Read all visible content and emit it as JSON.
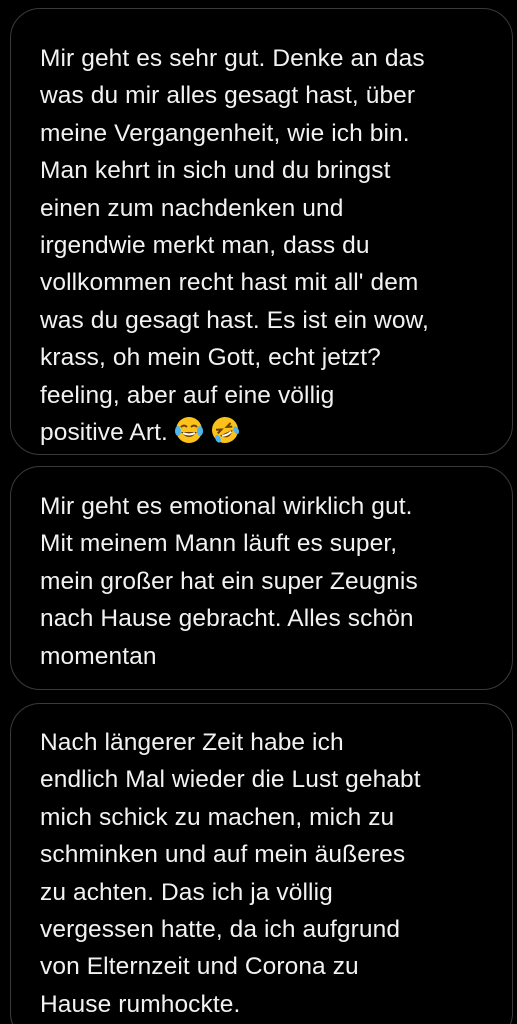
{
  "messages": [
    {
      "text": "Mir geht es sehr gut. Denke an das\nwas du mir alles gesagt hast, über\nmeine Vergangenheit, wie ich bin.\nMan kehrt in sich und du bringst\neinen zum nachdenken und\nirgendwie merkt man, dass du\nvollkommen recht hast mit all' dem\nwas du gesagt hast. Es ist ein wow,\nkrass, oh mein Gott, echt jetzt?\nfeeling, aber auf eine völlig\npositive Art.",
      "emojis": [
        "face-with-tears-of-joy-icon",
        "rolling-on-the-floor-laughing-icon"
      ]
    },
    {
      "text": "Mir geht es emotional wirklich gut.\nMit meinem Mann läuft es super,\nmein großer hat ein super Zeugnis\nnach Hause gebracht. Alles schön\nmomentan"
    },
    {
      "text": "Nach längerer Zeit habe ich\nendlich Mal wieder die Lust gehabt\nmich schick zu machen, mich zu\nschminken und auf mein äußeres\nzu achten. Das ich ja völlig\nvergessen hatte, da ich aufgrund\nvon Elternzeit und Corona zu\nHause rumhockte."
    }
  ],
  "colors": {
    "background": "#000000",
    "bubble_border": "#3a3a3c",
    "text": "#f2f2f2",
    "emoji_face": "#fcc21b"
  }
}
